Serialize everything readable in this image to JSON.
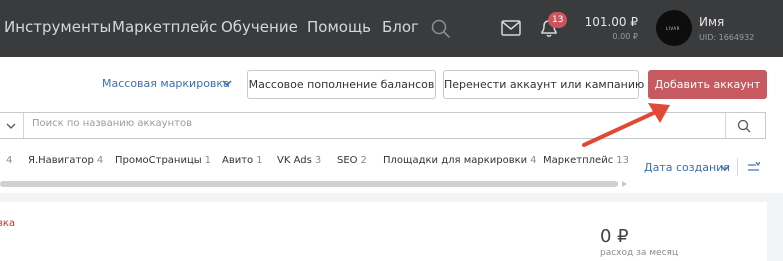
{
  "topbar": {
    "nav": [
      "Инструменты",
      "Маркетплейс",
      "Обучение",
      "Помощь",
      "Блог"
    ],
    "notifications_count": "13",
    "balance_main": "101.00 ₽",
    "balance_sub": "0.00 ₽",
    "user_name": "Имя",
    "user_uid": "UID: 1664932",
    "avatar_text": "LIVAR"
  },
  "toolbar": {
    "mass_marking": "Массовая маркировка",
    "mass_topup": "Массовое пополнение балансов",
    "transfer": "Перенести аккаунт или кампанию",
    "add_account": "Добавить аккаунт"
  },
  "search": {
    "placeholder": "Поиск по названию аккаунтов"
  },
  "tabs": [
    {
      "label": "",
      "count": "4"
    },
    {
      "label": "Я.Навигатор",
      "count": "4"
    },
    {
      "label": "ПромоСтраницы",
      "count": "1"
    },
    {
      "label": "Авито",
      "count": "1"
    },
    {
      "label": "VK Ads",
      "count": "3"
    },
    {
      "label": "SEO",
      "count": "2"
    },
    {
      "label": "Площадки для маркировки",
      "count": "4"
    },
    {
      "label": "Маркетплейс",
      "count": "13"
    }
  ],
  "sort": {
    "label": "Дата создания"
  },
  "card": {
    "status_text": "вка",
    "amount": "0 ₽",
    "amount_caption": "расход за месяц"
  },
  "colors": {
    "topbar_bg": "#3a3b3d",
    "accent_red": "#c65a60",
    "link_blue": "#3a6fb0",
    "arrow_red": "#e04a35"
  }
}
